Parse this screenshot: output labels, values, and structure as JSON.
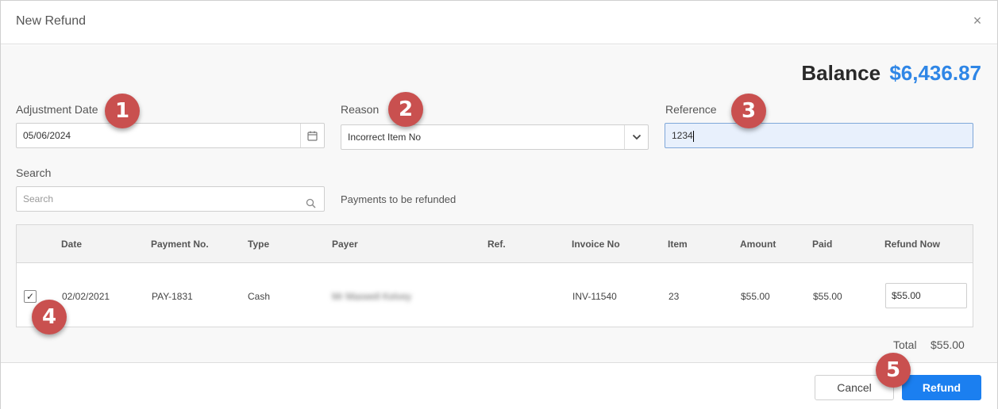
{
  "dialog": {
    "title": "New Refund",
    "close_glyph": "×"
  },
  "balance": {
    "label": "Balance",
    "amount": "$6,436.87"
  },
  "form": {
    "adjustment_date": {
      "label": "Adjustment Date",
      "value": "05/06/2024"
    },
    "reason": {
      "label": "Reason",
      "value": "Incorrect Item No"
    },
    "reference": {
      "label": "Reference",
      "value": "1234"
    },
    "search": {
      "label": "Search",
      "placeholder": "Search"
    },
    "payments_caption": "Payments to be refunded"
  },
  "table": {
    "headers": [
      "Date",
      "Payment No.",
      "Type",
      "Payer",
      "Ref.",
      "Invoice No",
      "Item",
      "Amount",
      "Paid",
      "Refund Now"
    ],
    "rows": [
      {
        "checked": "✓",
        "date": "02/02/2021",
        "payment_no": "PAY-1831",
        "type": "Cash",
        "payer": "Mr Maxwell Kelvey",
        "ref": "",
        "invoice_no": "INV-11540",
        "item": "23",
        "amount": "$55.00",
        "paid": "$55.00",
        "refund_now": "$55.00"
      }
    ]
  },
  "total": {
    "label": "Total",
    "value": "$55.00"
  },
  "buttons": {
    "cancel": "Cancel",
    "refund": "Refund"
  },
  "annotations": [
    "1",
    "2",
    "3",
    "4",
    "5"
  ],
  "icons": {
    "calendar": "calendar-icon",
    "chevron": "chevron-down-icon",
    "search": "search-icon",
    "close": "close-icon"
  },
  "colors": {
    "accent": "#1b7ff0",
    "balance_amount": "#2f86e6",
    "annotation_badge": "#c9504f"
  }
}
